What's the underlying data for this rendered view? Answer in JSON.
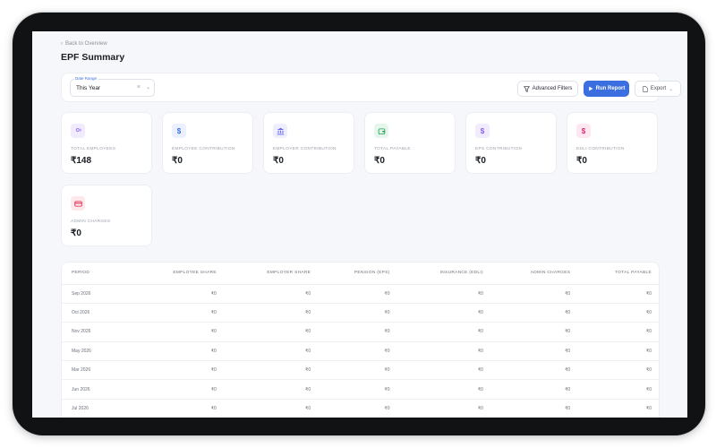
{
  "nav": {
    "back_label": "Back to Overview"
  },
  "page": {
    "title": "EPF Summary"
  },
  "filters": {
    "date_range_label": "Date Range",
    "date_range_value": "This Year",
    "advanced_filters_label": "Advanced Filters",
    "run_report_label": "Run Report",
    "export_label": "Export"
  },
  "colors": {
    "accent": "#3b6fe0"
  },
  "cards": [
    {
      "label": "TOTAL EMPLOYEES",
      "value": "₹148",
      "icon": "users-icon",
      "icon_color": "#8b5cf6",
      "icon_bg": "#f1ebfe"
    },
    {
      "label": "EMPLOYEE CONTRIBUTION",
      "value": "₹0",
      "icon": "dollar-icon",
      "icon_color": "#3b6fe0",
      "icon_bg": "#eaf0fd"
    },
    {
      "label": "EMPLOYER CONTRIBUTION",
      "value": "₹0",
      "icon": "bank-icon",
      "icon_color": "#6366f1",
      "icon_bg": "#eeeefd"
    },
    {
      "label": "TOTAL PAYABLE",
      "value": "₹0",
      "icon": "wallet-icon",
      "icon_color": "#16a34a",
      "icon_bg": "#e7f6ec"
    },
    {
      "label": "EPS CONTRIBUTION",
      "value": "₹0",
      "icon": "dollar-icon",
      "icon_color": "#8b5cf6",
      "icon_bg": "#f1ebfe"
    },
    {
      "label": "EDLI CONTRIBUTION",
      "value": "₹0",
      "icon": "dollar-icon",
      "icon_color": "#db2777",
      "icon_bg": "#fde8f1"
    },
    {
      "label": "ADMIN CHARGES",
      "value": "₹0",
      "icon": "card-icon",
      "icon_color": "#e11d48",
      "icon_bg": "#fde8ec"
    }
  ],
  "table": {
    "columns": [
      "PERIOD",
      "EMPLOYEE SHARE",
      "EMPLOYER SHARE",
      "PENSION (EPS)",
      "INSURANCE (EDLI)",
      "ADMIN CHARGES",
      "TOTAL PAYABLE"
    ],
    "rows": [
      [
        "Sep 2026",
        "₹0",
        "₹0",
        "₹0",
        "₹0",
        "₹0",
        "₹0"
      ],
      [
        "Oct 2026",
        "₹0",
        "₹0",
        "₹0",
        "₹0",
        "₹0",
        "₹0"
      ],
      [
        "Nov 2026",
        "₹0",
        "₹0",
        "₹0",
        "₹0",
        "₹0",
        "₹0"
      ],
      [
        "May 2026",
        "₹0",
        "₹0",
        "₹0",
        "₹0",
        "₹0",
        "₹0"
      ],
      [
        "Mar 2026",
        "₹0",
        "₹0",
        "₹0",
        "₹0",
        "₹0",
        "₹0"
      ],
      [
        "Jun 2026",
        "₹0",
        "₹0",
        "₹0",
        "₹0",
        "₹0",
        "₹0"
      ],
      [
        "Jul 2026",
        "₹0",
        "₹0",
        "₹0",
        "₹0",
        "₹0",
        "₹0"
      ]
    ]
  }
}
